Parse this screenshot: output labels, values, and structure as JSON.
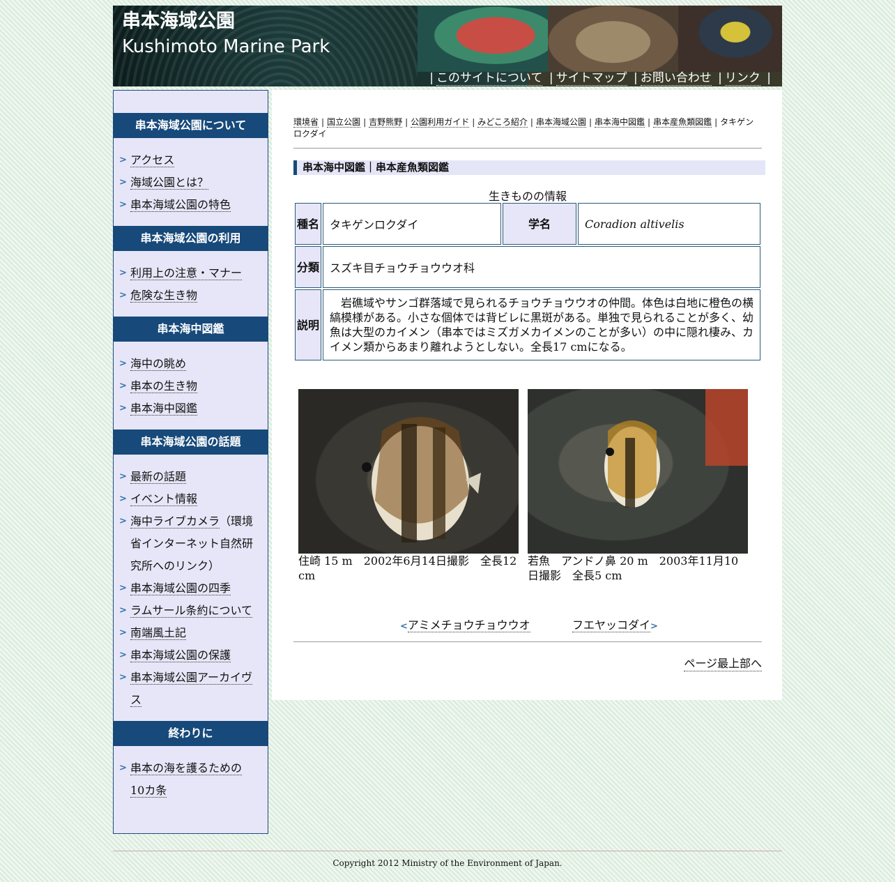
{
  "header": {
    "title_jp": "串本海域公園",
    "title_en": "Kushimoto Marine Park",
    "nav": [
      "このサイトについて",
      "サイトマップ",
      "お問い合わせ",
      "リンク"
    ]
  },
  "sidebar": {
    "sections": [
      {
        "heading": "串本海域公園について",
        "items": [
          "アクセス",
          "海域公園とは？",
          "串本海域公園の特色"
        ]
      },
      {
        "heading": "串本海域公園の利用",
        "items": [
          "利用上の注意・マナー",
          "危険な生き物"
        ]
      },
      {
        "heading": "串本海中図鑑",
        "items": [
          "海中の眺め",
          "串本の生き物",
          "串本海中図鑑"
        ]
      },
      {
        "heading": "串本海域公園の話題",
        "items": [
          "最新の話題",
          "イベント情報",
          "海中ライブカメラ",
          "串本海域公園の四季",
          "ラムサール条約について",
          "南端風土記",
          "串本海域公園の保護",
          "串本海域公園アーカイヴス"
        ],
        "livecam_note": "（環境省インターネット自然研究所へのリンク）"
      },
      {
        "heading": "終わりに",
        "items": [
          "串本の海を護るための10カ条"
        ]
      }
    ]
  },
  "breadcrumb": {
    "links": [
      "環境省",
      "国立公園",
      "吉野熊野",
      "公園利用ガイド",
      "みどころ紹介",
      "串本海域公園",
      "串本海中図鑑",
      "串本産魚類図鑑"
    ],
    "current": "タキゲンロクダイ"
  },
  "main": {
    "heading": "串本海中図鑑｜串本産魚類図鑑",
    "table_caption": "生きものの情報",
    "labels": {
      "species": "種名",
      "scientific": "学名",
      "classification": "分類",
      "description": "説明"
    },
    "species_name": "タキゲンロクダイ",
    "scientific_name": "Coradion altivelis",
    "classification": "スズキ目チョウチョウウオ科",
    "description": "岩礁域やサンゴ群落域で見られるチョウチョウウオの仲間。体色は白地に橙色の横縞模様がある。小さな個体では背ビレに黒斑がある。単独で見られることが多く、幼魚は大型のカイメン（串本ではミズガメカイメンのことが多い）の中に隠れ棲み、カイメン類からあまり離れようとしない。全長17 cmになる。",
    "photos": [
      {
        "caption": "住崎 15 m　2002年6月14日撮影　全長12 cm"
      },
      {
        "caption": "若魚　アンドノ鼻 20 m　2003年11月10日撮影　全長5 cm"
      }
    ],
    "prev": "アミメチョウチョウウオ",
    "next": "フエヤッコダイ",
    "arrow_prev": "<",
    "arrow_next": ">",
    "page_top": "ページ最上部へ"
  },
  "footer": {
    "copyright": "Copyright 2012 Ministry of the Environment of Japan."
  },
  "colors": {
    "nav_blue": "#17497a",
    "sidebar_bg": "#e6e6f8",
    "accent": "#2f6fa8"
  }
}
